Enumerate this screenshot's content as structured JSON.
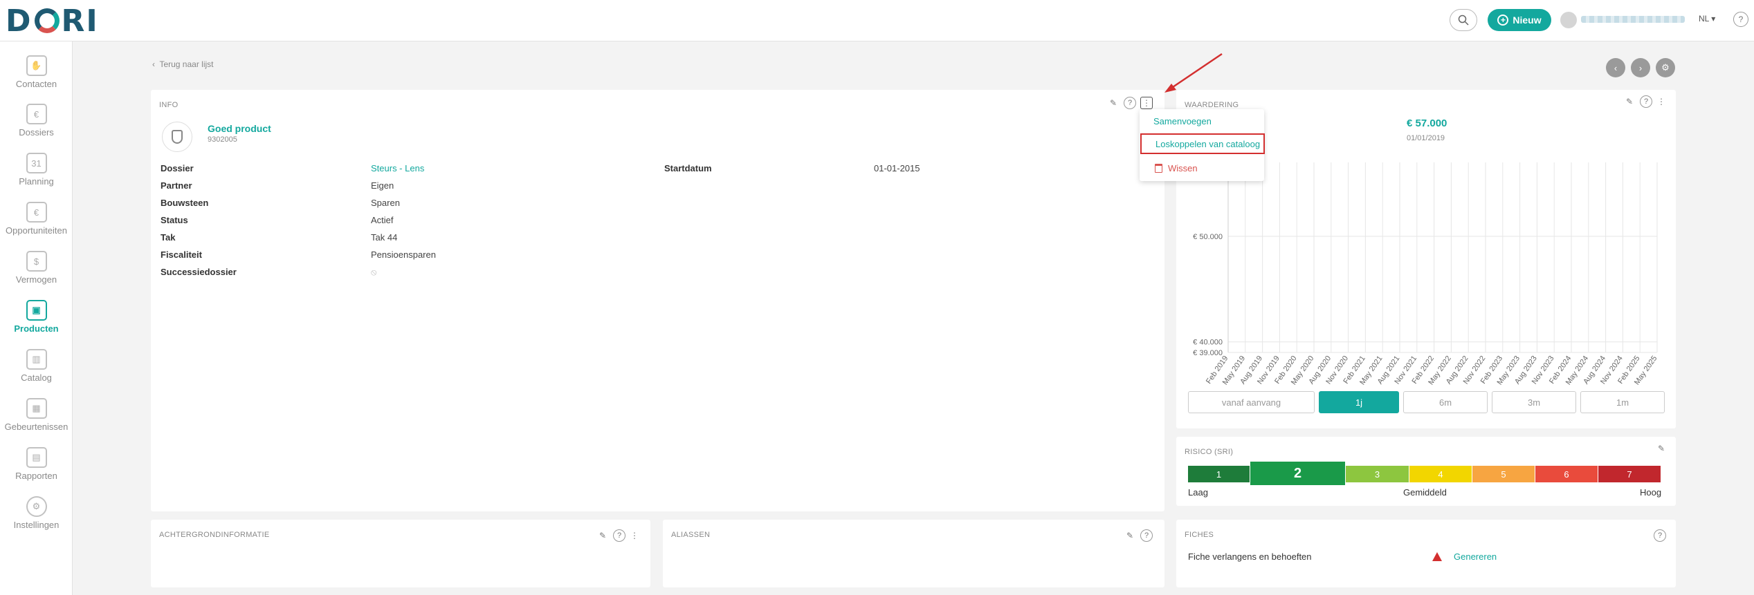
{
  "header": {
    "logo": "DORI",
    "new_button": "Nieuw",
    "language": "NL ▾",
    "help": "?"
  },
  "sidebar": {
    "items": [
      {
        "label": "Contacten",
        "icon": "handshake-icon"
      },
      {
        "label": "Dossiers",
        "icon": "folder-icon"
      },
      {
        "label": "Planning",
        "icon": "calendar-icon"
      },
      {
        "label": "Opportuniteiten",
        "icon": "lightbulb-icon"
      },
      {
        "label": "Vermogen",
        "icon": "coins-icon"
      },
      {
        "label": "Producten",
        "icon": "wallet-icon"
      },
      {
        "label": "Catalog",
        "icon": "catalog-icon"
      },
      {
        "label": "Gebeurtenissen",
        "icon": "events-icon"
      },
      {
        "label": "Rapporten",
        "icon": "reports-icon"
      },
      {
        "label": "Instellingen",
        "icon": "gear-icon"
      }
    ],
    "active": "Producten"
  },
  "page": {
    "back_link": "Terug naar lijst"
  },
  "info": {
    "title": "INFO",
    "product_name": "Goed product",
    "product_code": "9302005",
    "fields_left": [
      {
        "label": "Dossier",
        "value": "Steurs - Lens"
      },
      {
        "label": "Partner",
        "value": "Eigen"
      },
      {
        "label": "Bouwsteen",
        "value": "Sparen"
      },
      {
        "label": "Status",
        "value": "Actief"
      },
      {
        "label": "Tak",
        "value": "Tak 44"
      },
      {
        "label": "Fiscaliteit",
        "value": "Pensioensparen"
      },
      {
        "label": "Successiedossier",
        "value": ""
      }
    ],
    "fields_right": [
      {
        "label": "Startdatum",
        "value": "01-01-2015"
      }
    ]
  },
  "menu": {
    "items": [
      "Samenvoegen",
      "Loskoppelen van cataloog",
      "Wissen"
    ]
  },
  "waardering": {
    "title": "WAARDERING",
    "current_value": "€ 57.000",
    "current_date": "01/01/2019",
    "range_buttons": [
      "vanaf aanvang",
      "1j",
      "6m",
      "3m",
      "1m"
    ],
    "active_range": "1j"
  },
  "chart_data": {
    "type": "line",
    "x": [
      "Feb 2019",
      "May 2019",
      "Aug 2019",
      "Nov 2019",
      "Feb 2020",
      "May 2020",
      "Aug 2020",
      "Nov 2020",
      "Feb 2021",
      "May 2021",
      "Aug 2021",
      "Nov 2021",
      "Feb 2022",
      "May 2022",
      "Aug 2022",
      "Nov 2022",
      "Feb 2023",
      "May 2023",
      "Aug 2023",
      "Nov 2023",
      "Feb 2024",
      "May 2024",
      "Aug 2024",
      "Nov 2024",
      "Feb 2025",
      "May 2025"
    ],
    "y_ticks": [
      "€ 50.000",
      "€ 40.000",
      "€ 39.000"
    ],
    "y_tick_values": [
      50000,
      40000,
      39000
    ],
    "ylim": [
      39000,
      57000
    ],
    "grid": true,
    "series": []
  },
  "risico": {
    "title": "RISICO (SRI)",
    "levels": [
      {
        "label": "1",
        "color": "#1e7c3a"
      },
      {
        "label": "2",
        "color": "#1a9a49"
      },
      {
        "label": "3",
        "color": "#8dc63f"
      },
      {
        "label": "4",
        "color": "#f2d600"
      },
      {
        "label": "5",
        "color": "#f7a541"
      },
      {
        "label": "6",
        "color": "#e94b3c"
      },
      {
        "label": "7",
        "color": "#c1272d"
      }
    ],
    "active_level": 2,
    "scale_low": "Laag",
    "scale_mid": "Gemiddeld",
    "scale_high": "Hoog"
  },
  "achtergrond": {
    "title": "ACHTERGRONDINFORMATIE"
  },
  "aliassen": {
    "title": "ALIASSEN"
  },
  "fiches": {
    "title": "FICHES",
    "row_label": "Fiche verlangens en behoeften",
    "row_action": "Genereren"
  },
  "colors": {
    "accent": "#13a89e",
    "brand": "#1f5a72",
    "danger": "#d32f2f"
  }
}
